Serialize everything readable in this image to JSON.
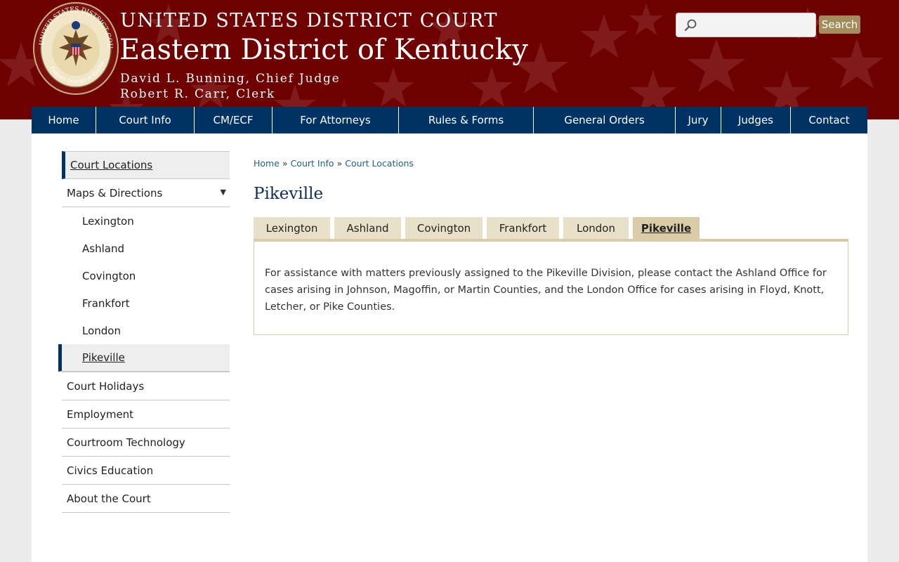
{
  "header": {
    "title_line1": "UNITED STATES DISTRICT COURT",
    "title_line2": "Eastern District of Kentucky",
    "chief_judge": "David L. Bunning, Chief Judge",
    "clerk": "Robert R. Carr, Clerk",
    "seal_text_top": "UNITED STATES DISTRICT COURT",
    "seal_text_bottom": "Eastern District of Kentucky",
    "background_color": "#6e0000"
  },
  "search": {
    "placeholder": "",
    "value": "",
    "button_label": "Search",
    "icon": "search-icon"
  },
  "nav": {
    "color": "#003365",
    "items": [
      {
        "label": "Home"
      },
      {
        "label": "Court Info"
      },
      {
        "label": "CM/ECF"
      },
      {
        "label": "For Attorneys"
      },
      {
        "label": "Rules & Forms"
      },
      {
        "label": "General Orders"
      },
      {
        "label": "Jury"
      },
      {
        "label": "Judges"
      },
      {
        "label": "Contact"
      }
    ]
  },
  "sidebar": {
    "top": "Court Locations",
    "maps": "Maps & Directions",
    "sub": [
      "Lexington",
      "Ashland",
      "Covington",
      "Frankfort",
      "London",
      "Pikeville"
    ],
    "items": [
      "Court Holidays",
      "Employment",
      "Courtroom Technology",
      "Civics Education",
      "About the Court"
    ]
  },
  "breadcrumb": {
    "items": [
      "Home",
      "Court Info",
      "Court Locations"
    ],
    "separator": "»"
  },
  "page_title": "Pikeville",
  "tabs": [
    "Lexington",
    "Ashland",
    "Covington",
    "Frankfort",
    "London",
    "Pikeville"
  ],
  "active_tab": "Pikeville",
  "tab_content": "For assistance with matters previously assigned to the Pikeville Division, please contact the Ashland Office for cases arising in Johnson, Magoffin, or Martin Counties, and the London Office for cases arising in Floyd, Knott, Letcher, or Pike Counties."
}
